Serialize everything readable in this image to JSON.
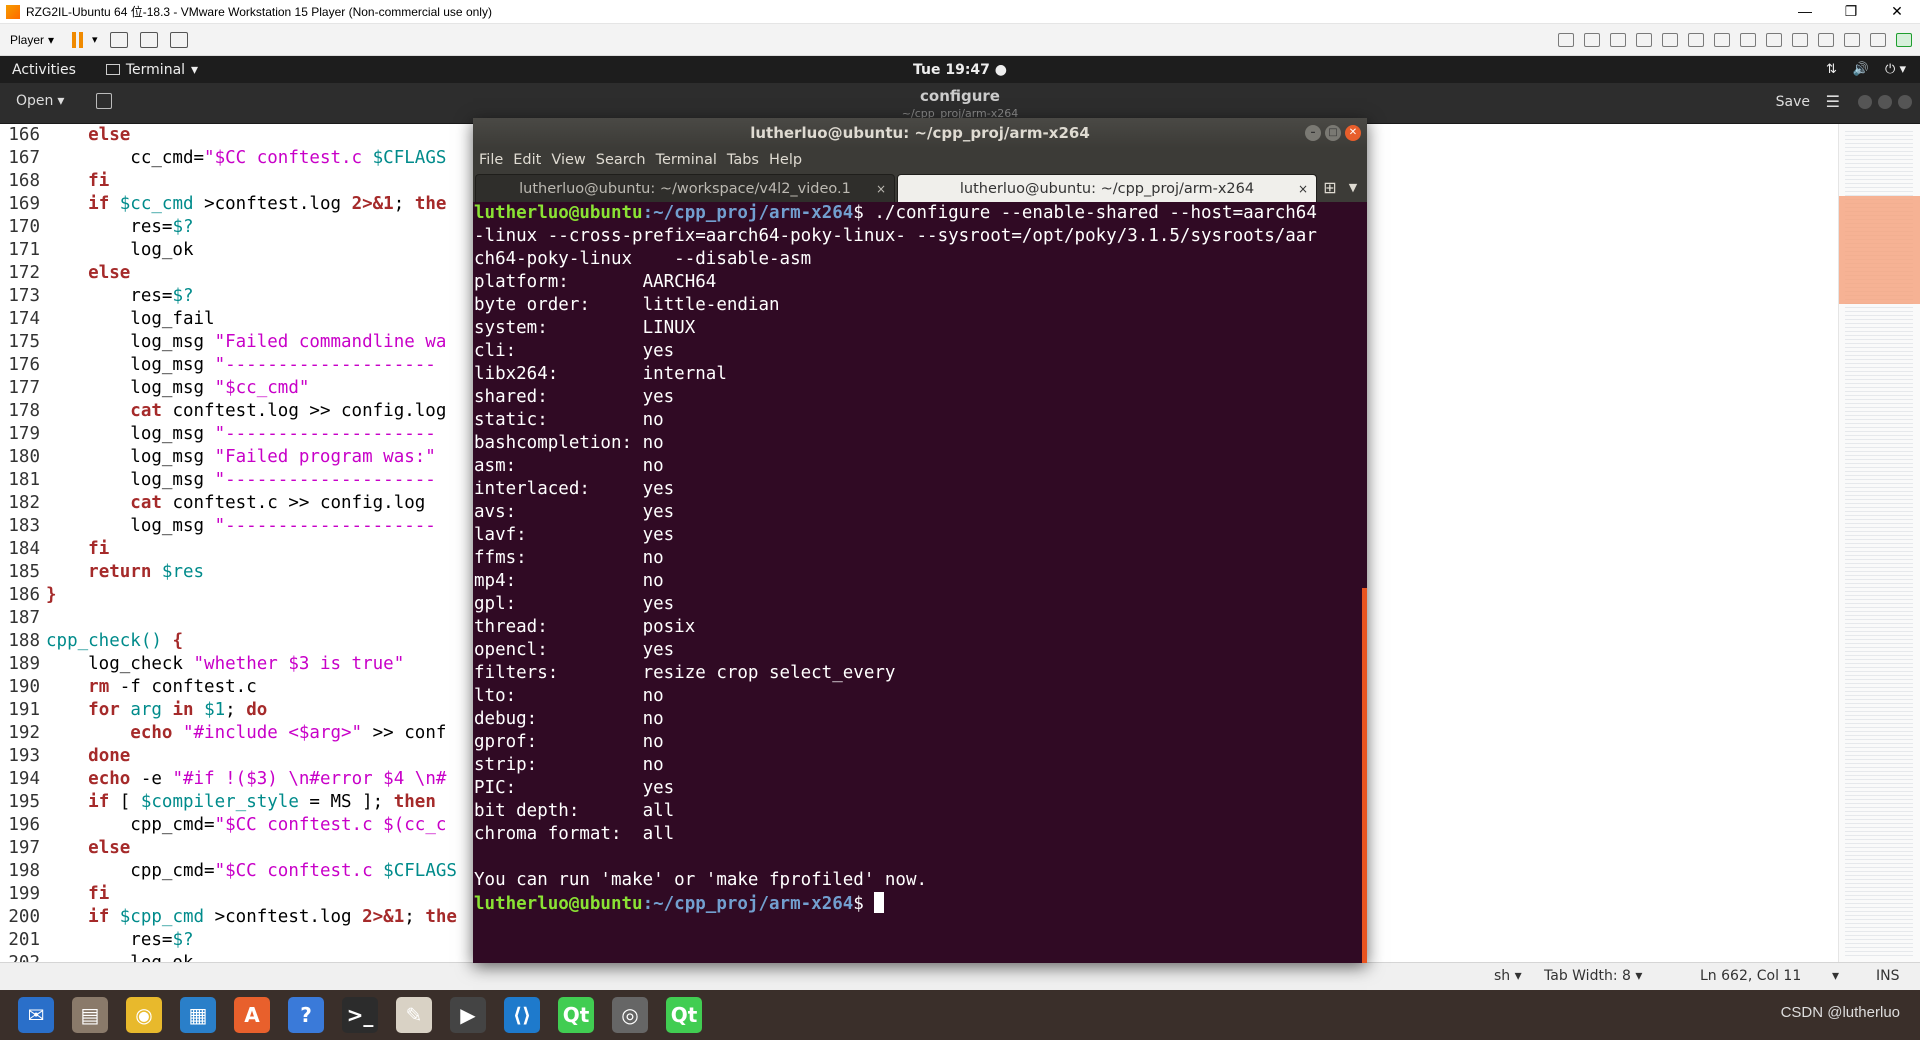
{
  "vm": {
    "title": "RZG2IL-Ubuntu 64 位-18.3 - VMware Workstation 15 Player (Non-commercial use only)",
    "player_menu": "Player",
    "min": "—",
    "max": "❐",
    "close": "✕"
  },
  "topbar": {
    "activities": "Activities",
    "app_menu": "Terminal",
    "clock": "Tue 19:47 ●",
    "sys_icons": [
      "⇅",
      "🔊",
      "⏻ ▾"
    ]
  },
  "gedit": {
    "open_label": "Open",
    "title": "configure",
    "subtitle": "~/cpp_proj/arm-x264",
    "save_label": "Save",
    "menu_icon": "☰"
  },
  "code_lines": [
    {
      "n": "166",
      "s": [
        [
          "    ",
          ""
        ],
        [
          "else",
          "kw"
        ]
      ]
    },
    {
      "n": "167",
      "s": [
        [
          "        cc_cmd=",
          ""
        ],
        [
          "\"$CC ",
          "st"
        ],
        [
          "conftest.c ",
          "st"
        ],
        [
          "$CFLAGS",
          "vr"
        ]
      ]
    },
    {
      "n": "168",
      "s": [
        [
          "    ",
          ""
        ],
        [
          "fi",
          "kw"
        ]
      ]
    },
    {
      "n": "169",
      "s": [
        [
          "    ",
          ""
        ],
        [
          "if ",
          "kw"
        ],
        [
          "$cc_cmd ",
          "vr"
        ],
        [
          ">conftest.log ",
          ""
        ],
        [
          "2>&1",
          "kw"
        ],
        [
          "; ",
          ""
        ],
        [
          "the",
          "kw"
        ]
      ]
    },
    {
      "n": "170",
      "s": [
        [
          "        res=",
          ""
        ],
        [
          "$?",
          "vr"
        ]
      ]
    },
    {
      "n": "171",
      "s": [
        [
          "        log_ok",
          ""
        ]
      ]
    },
    {
      "n": "172",
      "s": [
        [
          "    ",
          ""
        ],
        [
          "else",
          "kw"
        ]
      ]
    },
    {
      "n": "173",
      "s": [
        [
          "        res=",
          ""
        ],
        [
          "$?",
          "vr"
        ]
      ]
    },
    {
      "n": "174",
      "s": [
        [
          "        log_fail",
          ""
        ]
      ]
    },
    {
      "n": "175",
      "s": [
        [
          "        log_msg ",
          ""
        ],
        [
          "\"Failed commandline wa",
          "st"
        ]
      ]
    },
    {
      "n": "176",
      "s": [
        [
          "        log_msg ",
          ""
        ],
        [
          "\"--------------------",
          "st"
        ]
      ]
    },
    {
      "n": "177",
      "s": [
        [
          "        log_msg ",
          ""
        ],
        [
          "\"$cc_cmd\"",
          "st"
        ]
      ]
    },
    {
      "n": "178",
      "s": [
        [
          "        ",
          ""
        ],
        [
          "cat",
          "kw"
        ],
        [
          " conftest.log >> config.log",
          ""
        ]
      ]
    },
    {
      "n": "179",
      "s": [
        [
          "        log_msg ",
          ""
        ],
        [
          "\"--------------------",
          "st"
        ]
      ]
    },
    {
      "n": "180",
      "s": [
        [
          "        log_msg ",
          ""
        ],
        [
          "\"Failed program was:\"",
          "st"
        ]
      ]
    },
    {
      "n": "181",
      "s": [
        [
          "        log_msg ",
          ""
        ],
        [
          "\"--------------------",
          "st"
        ]
      ]
    },
    {
      "n": "182",
      "s": [
        [
          "        ",
          ""
        ],
        [
          "cat",
          "kw"
        ],
        [
          " conftest.c >> config.log",
          ""
        ]
      ]
    },
    {
      "n": "183",
      "s": [
        [
          "        log_msg ",
          ""
        ],
        [
          "\"--------------------",
          "st"
        ]
      ]
    },
    {
      "n": "184",
      "s": [
        [
          "    ",
          ""
        ],
        [
          "fi",
          "kw"
        ]
      ]
    },
    {
      "n": "185",
      "s": [
        [
          "    ",
          ""
        ],
        [
          "return ",
          "kw"
        ],
        [
          "$res",
          "vr"
        ]
      ]
    },
    {
      "n": "186",
      "s": [
        [
          "}",
          "kw"
        ]
      ]
    },
    {
      "n": "187",
      "s": [
        [
          "",
          ""
        ]
      ]
    },
    {
      "n": "188",
      "s": [
        [
          "cpp_check() ",
          "fn"
        ],
        [
          "{",
          "kw"
        ]
      ]
    },
    {
      "n": "189",
      "s": [
        [
          "    log_check ",
          ""
        ],
        [
          "\"whether $3 is true\"",
          "st"
        ]
      ]
    },
    {
      "n": "190",
      "s": [
        [
          "    ",
          ""
        ],
        [
          "rm",
          "kw"
        ],
        [
          " -f conftest.c",
          ""
        ]
      ]
    },
    {
      "n": "191",
      "s": [
        [
          "    ",
          ""
        ],
        [
          "for ",
          "kw"
        ],
        [
          "arg ",
          "vr"
        ],
        [
          "in ",
          "kw"
        ],
        [
          "$1",
          "vr"
        ],
        [
          "; ",
          ""
        ],
        [
          "do",
          "kw"
        ]
      ]
    },
    {
      "n": "192",
      "s": [
        [
          "        ",
          ""
        ],
        [
          "echo ",
          "kw"
        ],
        [
          "\"#include <$arg>\"",
          "st"
        ],
        [
          " >> conf",
          ""
        ]
      ]
    },
    {
      "n": "193",
      "s": [
        [
          "    ",
          ""
        ],
        [
          "done",
          "kw"
        ]
      ]
    },
    {
      "n": "194",
      "s": [
        [
          "    ",
          ""
        ],
        [
          "echo",
          "kw"
        ],
        [
          " -e ",
          ""
        ],
        [
          "\"#if !($3) \\n#error $4 \\n#",
          "st"
        ]
      ]
    },
    {
      "n": "195",
      "s": [
        [
          "    ",
          ""
        ],
        [
          "if ",
          "kw"
        ],
        [
          "[ ",
          ""
        ],
        [
          "$compiler_style",
          "vr"
        ],
        [
          " = MS ]; ",
          ""
        ],
        [
          "then",
          "kw"
        ]
      ]
    },
    {
      "n": "196",
      "s": [
        [
          "        cpp_cmd=",
          ""
        ],
        [
          "\"$CC ",
          "st"
        ],
        [
          "conftest.c ",
          "st"
        ],
        [
          "$(cc_c",
          "st"
        ]
      ]
    },
    {
      "n": "197",
      "s": [
        [
          "    ",
          ""
        ],
        [
          "else",
          "kw"
        ]
      ]
    },
    {
      "n": "198",
      "s": [
        [
          "        cpp_cmd=",
          ""
        ],
        [
          "\"$CC ",
          "st"
        ],
        [
          "conftest.c ",
          "st"
        ],
        [
          "$CFLAGS",
          "vr"
        ]
      ]
    },
    {
      "n": "199",
      "s": [
        [
          "    ",
          ""
        ],
        [
          "fi",
          "kw"
        ]
      ]
    },
    {
      "n": "200",
      "s": [
        [
          "    ",
          ""
        ],
        [
          "if ",
          "kw"
        ],
        [
          "$cpp_cmd ",
          "vr"
        ],
        [
          ">conftest.log ",
          ""
        ],
        [
          "2>&1",
          "kw"
        ],
        [
          "; ",
          ""
        ],
        [
          "the",
          "kw"
        ]
      ]
    },
    {
      "n": "201",
      "s": [
        [
          "        res=",
          ""
        ],
        [
          "$?",
          "vr"
        ]
      ]
    },
    {
      "n": "202",
      "s": [
        [
          "        log_ok",
          ""
        ]
      ]
    }
  ],
  "statusbar": {
    "lang": "sh ▾",
    "tab_width": "Tab Width: 8 ▾",
    "position": "Ln 662, Col 11",
    "mode_menu": "▾",
    "ins": "INS"
  },
  "terminal": {
    "title": "lutherluo@ubuntu: ~/cpp_proj/arm-x264",
    "menu": [
      "File",
      "Edit",
      "View",
      "Search",
      "Terminal",
      "Tabs",
      "Help"
    ],
    "tabs": [
      {
        "label": "lutherluo@ubuntu: ~/workspace/v4l2_video.1",
        "active": false
      },
      {
        "label": "lutherluo@ubuntu: ~/cpp_proj/arm-x264",
        "active": true
      }
    ],
    "prompt_user": "lutherluo@ubuntu",
    "prompt_path": ":~/cpp_proj/arm-x264",
    "command_lines": [
      "$ ./configure --enable-shared --host=aarch64",
      "-linux --cross-prefix=aarch64-poky-linux- --sysroot=/opt/poky/3.1.5/sysroots/aar",
      "ch64-poky-linux    --disable-asm"
    ],
    "output": [
      [
        "platform:",
        "AARCH64"
      ],
      [
        "byte order:",
        "little-endian"
      ],
      [
        "system:",
        "LINUX"
      ],
      [
        "cli:",
        "yes"
      ],
      [
        "libx264:",
        "internal"
      ],
      [
        "shared:",
        "yes"
      ],
      [
        "static:",
        "no"
      ],
      [
        "bashcompletion:",
        "no"
      ],
      [
        "asm:",
        "no"
      ],
      [
        "interlaced:",
        "yes"
      ],
      [
        "avs:",
        "yes"
      ],
      [
        "lavf:",
        "yes"
      ],
      [
        "ffms:",
        "no"
      ],
      [
        "mp4:",
        "no"
      ],
      [
        "gpl:",
        "yes"
      ],
      [
        "thread:",
        "posix"
      ],
      [
        "opencl:",
        "yes"
      ],
      [
        "filters:",
        "resize crop select_every"
      ],
      [
        "lto:",
        "no"
      ],
      [
        "debug:",
        "no"
      ],
      [
        "gprof:",
        "no"
      ],
      [
        "strip:",
        "no"
      ],
      [
        "PIC:",
        "yes"
      ],
      [
        "bit depth:",
        "all"
      ],
      [
        "chroma format:",
        "all"
      ]
    ],
    "final_msg": "You can run 'make' or 'make fprofiled' now.",
    "final_prompt_tail": "$ "
  },
  "taskbar": {
    "items": [
      {
        "name": "thunderbird",
        "glyph": "✉",
        "color": "#2a6fc9"
      },
      {
        "name": "files",
        "glyph": "▤",
        "color": "#8a7a6a"
      },
      {
        "name": "rhythmbox",
        "glyph": "◉",
        "color": "#e8b92c"
      },
      {
        "name": "writer",
        "glyph": "▦",
        "color": "#2a7fc9"
      },
      {
        "name": "software",
        "glyph": "A",
        "color": "#e8602c"
      },
      {
        "name": "help",
        "glyph": "?",
        "color": "#3a7ad9"
      },
      {
        "name": "terminal",
        "glyph": ">_",
        "color": "#2c2c2c"
      },
      {
        "name": "text-editor",
        "glyph": "✎",
        "color": "#d9d2c5"
      },
      {
        "name": "video-editor",
        "glyph": "▶",
        "color": "#444"
      },
      {
        "name": "vscode",
        "glyph": "⟨⟩",
        "color": "#1e7acc"
      },
      {
        "name": "qt-designer",
        "glyph": "Qt",
        "color": "#41cd52"
      },
      {
        "name": "camera",
        "glyph": "◎",
        "color": "#666"
      },
      {
        "name": "qt-creator",
        "glyph": "Qt",
        "color": "#41cd52"
      }
    ],
    "watermark": "CSDN @lutherluo"
  }
}
